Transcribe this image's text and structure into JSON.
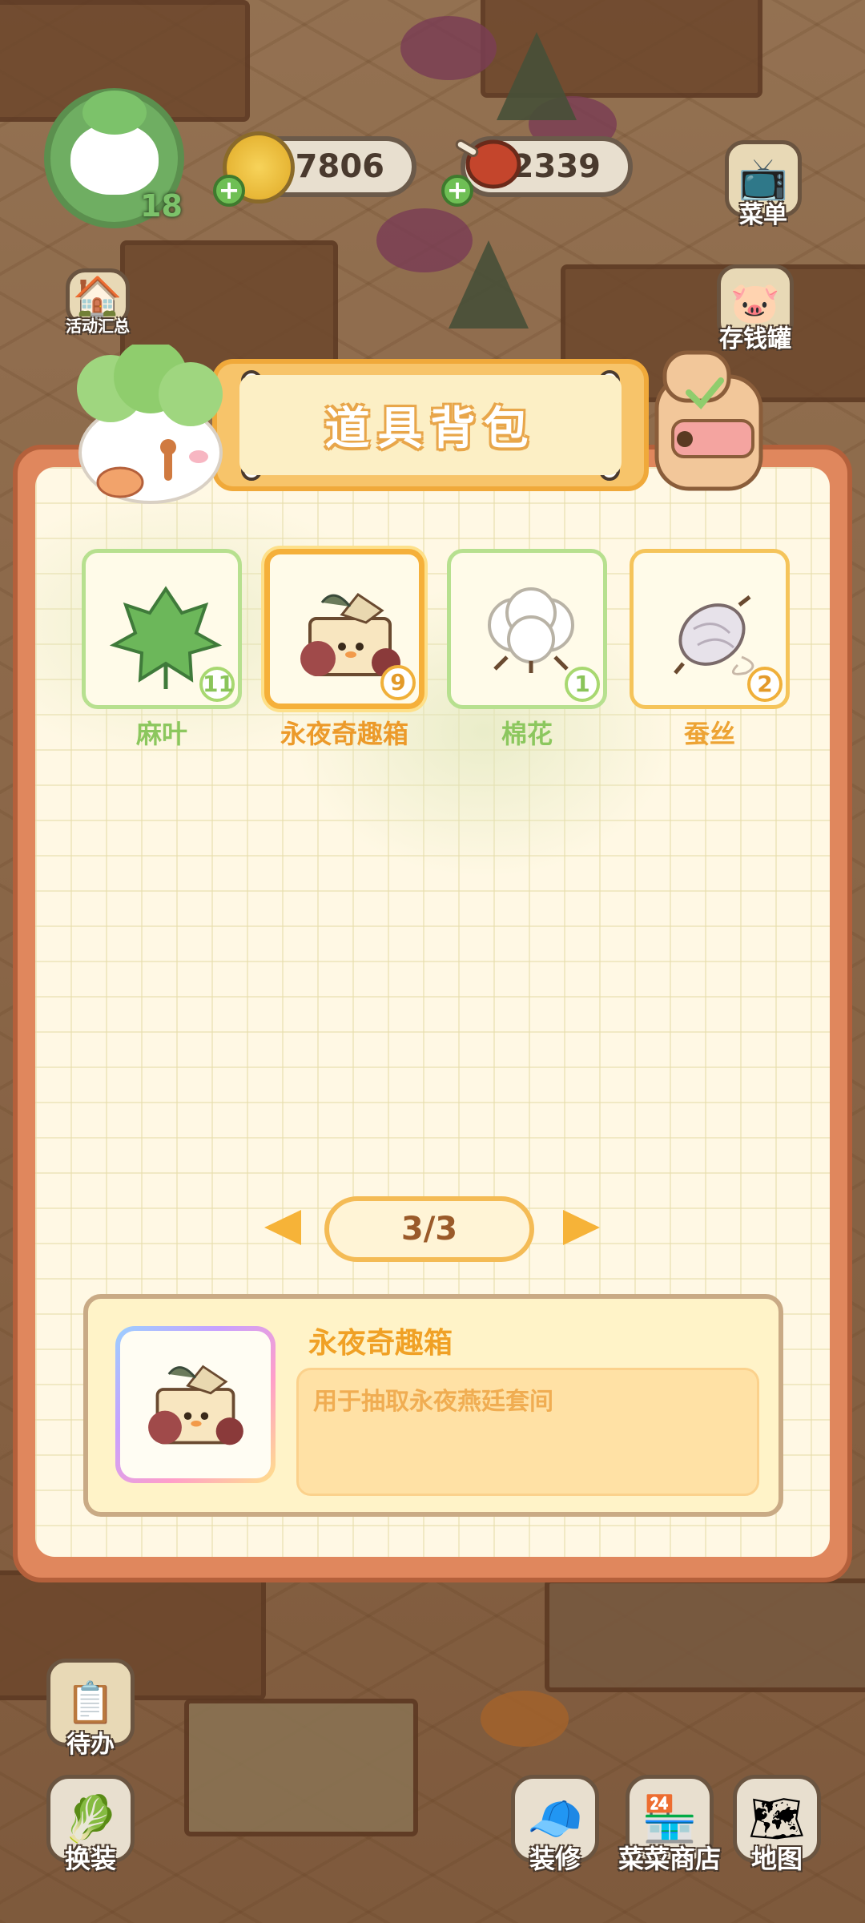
{
  "hud": {
    "level": "18",
    "coins": "7806",
    "meat": "2339"
  },
  "side_buttons": {
    "activity_summary": "活动汇总",
    "menu": "菜单",
    "piggy_bank": "存钱罐",
    "todo": "待办",
    "dressup": "换装"
  },
  "bottom_buttons": {
    "decorate": "装修",
    "shop": "菜菜商店",
    "map": "地图"
  },
  "panel": {
    "title": "道具背包",
    "items": [
      {
        "name": "麻叶",
        "count": "11",
        "icon": "hemp-leaf-icon"
      },
      {
        "name": "永夜奇趣箱",
        "count": "9",
        "icon": "mystery-box-icon",
        "selected": true
      },
      {
        "name": "棉花",
        "count": "1",
        "icon": "cotton-icon"
      },
      {
        "name": "蚕丝",
        "count": "2",
        "icon": "silk-icon"
      }
    ],
    "pager": "3/3",
    "detail": {
      "name": "永夜奇趣箱",
      "description": "用于抽取永夜燕廷套间"
    }
  }
}
